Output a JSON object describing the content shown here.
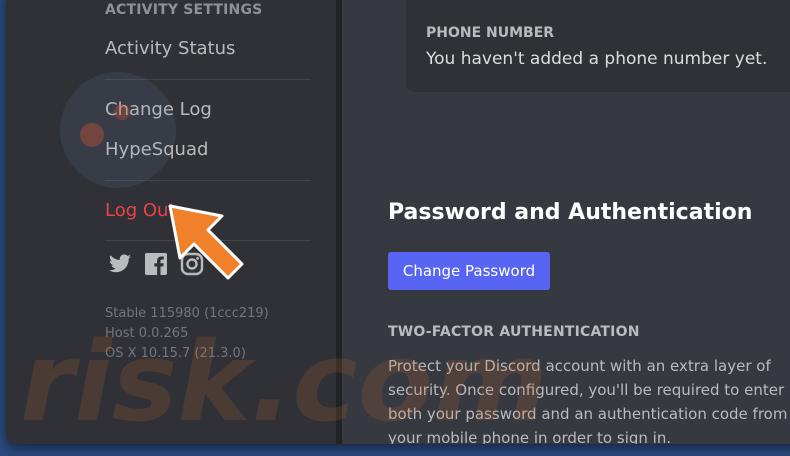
{
  "sidebar": {
    "section_header": "ACTIVITY SETTINGS",
    "items": [
      {
        "label": "Activity Status"
      },
      {
        "label": "Change Log"
      },
      {
        "label": "HypeSquad"
      },
      {
        "label": "Log Out"
      }
    ],
    "social_icons": [
      "twitter-icon",
      "facebook-icon",
      "instagram-icon"
    ],
    "version_lines": [
      "Stable 115980 (1ccc219)",
      "Host 0.0.265",
      "OS X 10.15.7 (21.3.0)"
    ]
  },
  "main": {
    "phone": {
      "label": "PHONE NUMBER",
      "value": "You haven't added a phone number yet."
    },
    "password_section": {
      "title": "Password and Authentication",
      "change_password_button": "Change Password"
    },
    "two_factor": {
      "label": "TWO-FACTOR AUTHENTICATION",
      "description": "Protect your Discord account with an extra layer of security. Once configured, you'll be required to enter both your password and an authentication code from your mobile phone in order to sign in."
    }
  },
  "watermark": "risk.com",
  "colors": {
    "accent": "#5865f2",
    "danger": "#ed4245",
    "arrow": "#f0812a"
  }
}
